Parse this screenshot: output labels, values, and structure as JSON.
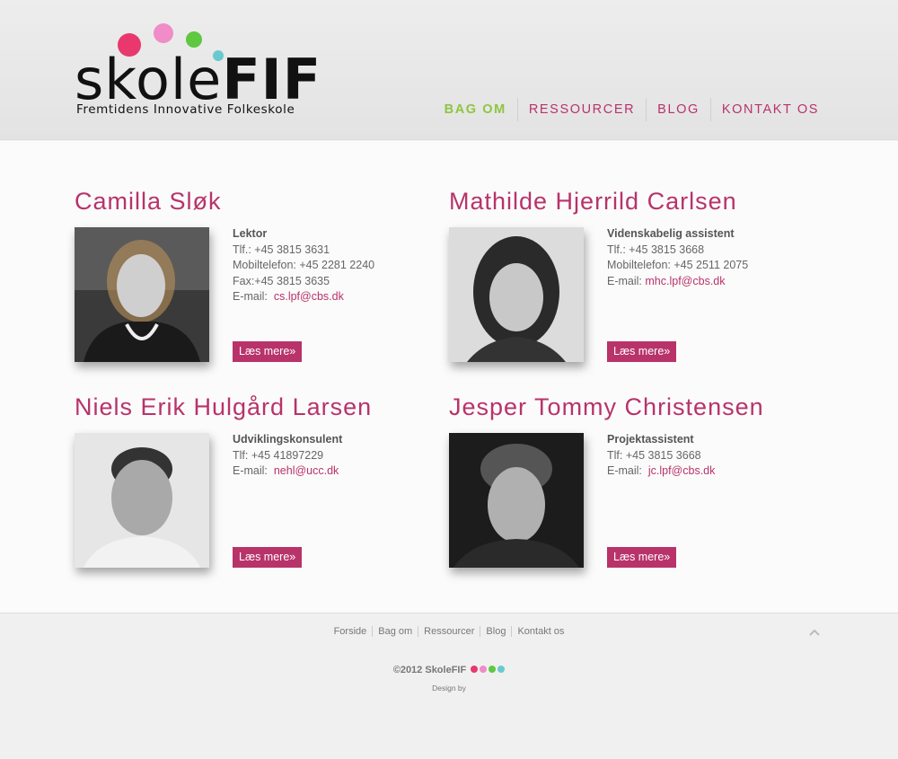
{
  "logo": {
    "word_light": "skole",
    "word_bold": "FIF",
    "tagline": "Fremtidens Innovative Folkeskole",
    "dot_colors": [
      "#e8386d",
      "#f08cc8",
      "#5ec840",
      "#6ac9d0"
    ]
  },
  "nav": {
    "items": [
      {
        "label": "BAG OM",
        "active": true
      },
      {
        "label": "RESSOURCER",
        "active": false
      },
      {
        "label": "BLOG",
        "active": false
      },
      {
        "label": "KONTAKT OS",
        "active": false
      }
    ]
  },
  "people": [
    {
      "name": "Camilla Sløk",
      "title": "Lektor",
      "lines": [
        "Tlf.: +45 3815 3631",
        "Mobiltelefon: +45 2281 2240",
        "Fax:+45 3815 3635"
      ],
      "email_label": "E-mail:",
      "email": "cs.lpf@cbs.dk",
      "more": "Læs mere»"
    },
    {
      "name": "Mathilde Hjerrild Carlsen",
      "title": "Videnskabelig assistent",
      "lines": [
        "Tlf.: +45 3815 3668",
        "Mobiltelefon: +45 2511 2075"
      ],
      "email_label": "E-mail:",
      "email": "mhc.lpf@cbs.dk",
      "more": "Læs mere»"
    },
    {
      "name": "Niels Erik Hulgård Larsen",
      "title": "Udviklingskonsulent",
      "lines": [
        "Tlf: +45 41897229"
      ],
      "email_label": "E-mail:",
      "email": "nehl@ucc.dk",
      "more": "Læs mere»"
    },
    {
      "name": "Jesper Tommy Christensen",
      "title": "Projektassistent",
      "lines": [
        "Tlf: +45 3815 3668"
      ],
      "email_label": "E-mail:",
      "email": "jc.lpf@cbs.dk",
      "more": "Læs mere»"
    }
  ],
  "footer": {
    "links": [
      "Forside",
      "Bag om",
      "Ressourcer",
      "Blog",
      "Kontakt os"
    ],
    "copyright": "©2012 Skole",
    "copyright_bold": "FIF",
    "design": "Design by",
    "to_top_icon": "chevron-up-icon"
  }
}
